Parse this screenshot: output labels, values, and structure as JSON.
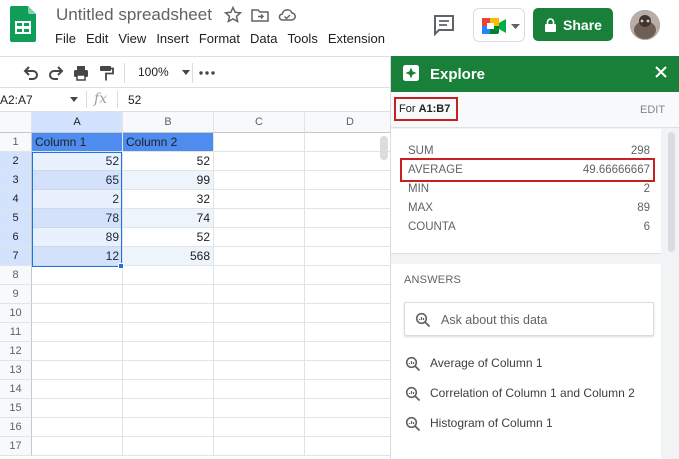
{
  "header": {
    "doc_title": "Untitled spreadsheet",
    "menu": [
      "File",
      "Edit",
      "View",
      "Insert",
      "Format",
      "Data",
      "Tools",
      "Extension"
    ],
    "share_label": "Share"
  },
  "toolbar": {
    "zoom": "100%"
  },
  "formula_bar": {
    "name_box": "A2:A7",
    "fx": "fx",
    "value": "52"
  },
  "grid": {
    "columns": [
      "A",
      "B",
      "C",
      "D"
    ],
    "rows": [
      "1",
      "2",
      "3",
      "4",
      "5",
      "6",
      "7",
      "8",
      "9",
      "10",
      "11",
      "12",
      "13",
      "14",
      "15",
      "16",
      "17"
    ],
    "headers": [
      "Column 1",
      "Column 2"
    ],
    "data": [
      [
        "52",
        "52"
      ],
      [
        "65",
        "99"
      ],
      [
        "2",
        "32"
      ],
      [
        "78",
        "74"
      ],
      [
        "89",
        "52"
      ],
      [
        "12",
        "568"
      ]
    ]
  },
  "explore": {
    "title": "Explore",
    "range_prefix": "For",
    "range": "A1:B7",
    "edit_label": "EDIT",
    "stats": [
      {
        "label": "SUM",
        "value": "298"
      },
      {
        "label": "AVERAGE",
        "value": "49.66666667"
      },
      {
        "label": "MIN",
        "value": "2"
      },
      {
        "label": "MAX",
        "value": "89"
      },
      {
        "label": "COUNTA",
        "value": "6"
      }
    ],
    "answers_title": "ANSWERS",
    "ask_placeholder": "Ask about this data",
    "suggestions": [
      "Average of Column 1",
      "Correlation of Column 1 and Column 2",
      "Histogram of Column 1"
    ]
  },
  "colors": {
    "brand_green": "#188038",
    "selection_blue": "#1a73e8",
    "header_fill": "#4f8cf0",
    "highlight_red": "#c5221f"
  },
  "icons": [
    "sheets-logo-icon",
    "star-icon",
    "move-folder-icon",
    "cloud-status-icon",
    "comment-icon",
    "meet-icon",
    "lock-icon",
    "undo-icon",
    "redo-icon",
    "print-icon",
    "paint-format-icon",
    "more-icon",
    "explore-icon",
    "close-icon",
    "search-data-icon"
  ]
}
